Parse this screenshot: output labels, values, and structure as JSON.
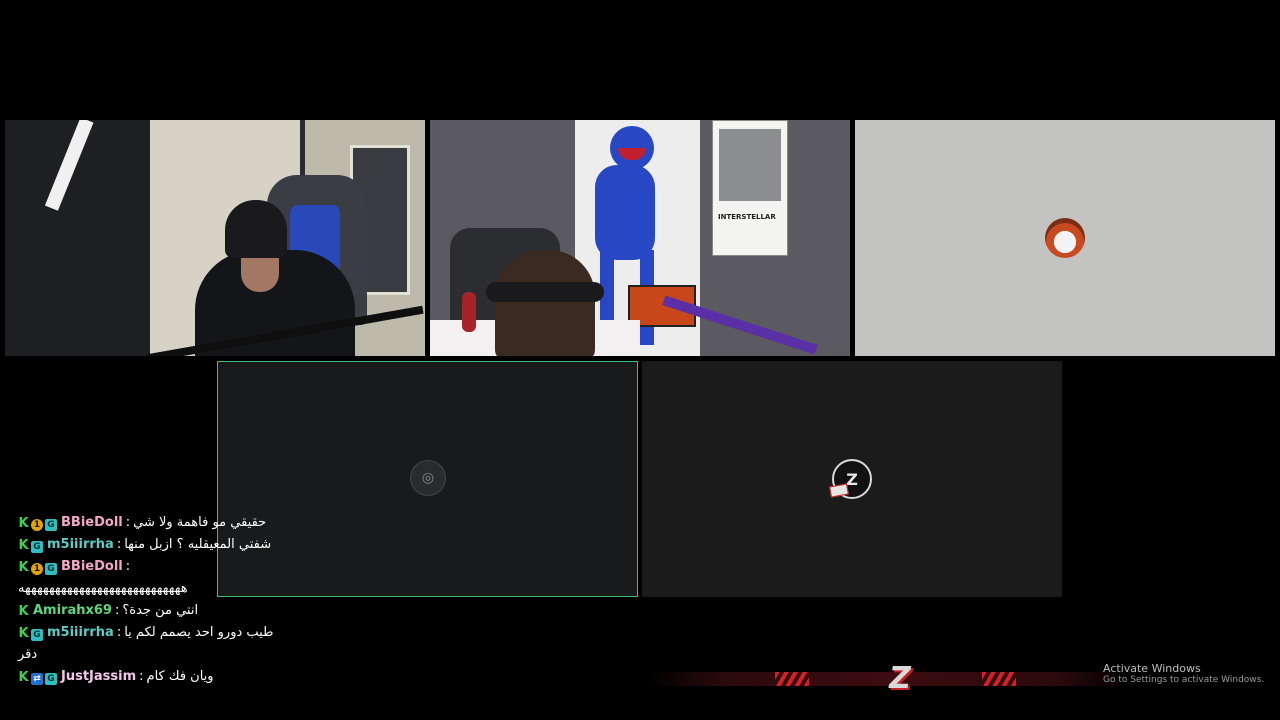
{
  "tiles": [
    {
      "id": "webcam-1",
      "kind": "video"
    },
    {
      "id": "webcam-2",
      "kind": "video",
      "poster_text": "INTERSTELLAR"
    },
    {
      "id": "participant-3",
      "kind": "avatar"
    },
    {
      "id": "participant-4",
      "kind": "avatar",
      "active_speaker": true
    },
    {
      "id": "participant-5",
      "kind": "avatar"
    }
  ],
  "chat": {
    "messages": [
      {
        "username": "BBieDoll",
        "badges": [
          "kick-icon",
          "sub-badge-icon",
          "gift-badge-icon"
        ],
        "separator": ":",
        "text": "حقيقي مو فاهمة ولا شي"
      },
      {
        "username": "m5iiirrha",
        "badges": [
          "kick-icon",
          "gift-badge-icon"
        ],
        "separator": ":",
        "text": "شفتي المعيقليه ؟ ازبل منها"
      },
      {
        "username": "BBieDoll",
        "badges": [
          "kick-icon",
          "sub-badge-icon",
          "gift-badge-icon"
        ],
        "separator": ":",
        "text": "هههههههههههههههههههههههههههه"
      },
      {
        "username": "Amirahx69",
        "badges": [
          "kick-icon"
        ],
        "separator": ":",
        "text": "انتي من جدة؟"
      },
      {
        "username": "m5iiirrha",
        "badges": [
          "kick-icon",
          "gift-badge-icon"
        ],
        "separator": ":",
        "text": "طيب دورو احد يصمم لكم يا",
        "text_cont": "دقر"
      },
      {
        "username": "JustJassim",
        "badges": [
          "kick-icon",
          "boost-badge-icon",
          "gift-badge-icon"
        ],
        "separator": ":",
        "text": "ويان فك كام"
      }
    ]
  },
  "overlay": {
    "brand_logo_text": "Z"
  },
  "watermark": {
    "title": "Activate Windows",
    "subtitle": "Go to Settings to activate Windows."
  },
  "colors": {
    "active_border": "#3fbf6a",
    "kick_green": "#3fd04f",
    "brand_red": "#d5202a"
  }
}
